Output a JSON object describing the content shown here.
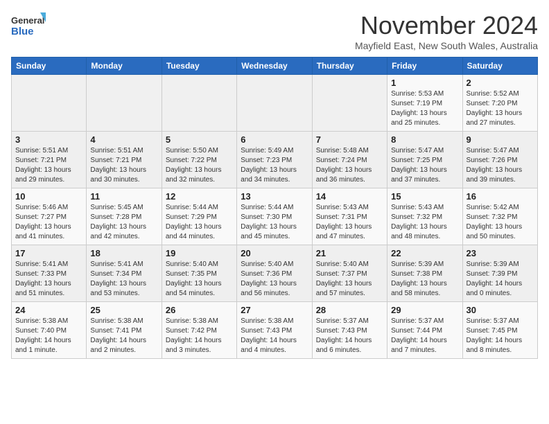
{
  "logo": {
    "line1": "General",
    "line2": "Blue"
  },
  "title": "November 2024",
  "subtitle": "Mayfield East, New South Wales, Australia",
  "weekdays": [
    "Sunday",
    "Monday",
    "Tuesday",
    "Wednesday",
    "Thursday",
    "Friday",
    "Saturday"
  ],
  "weeks": [
    [
      {
        "day": "",
        "info": ""
      },
      {
        "day": "",
        "info": ""
      },
      {
        "day": "",
        "info": ""
      },
      {
        "day": "",
        "info": ""
      },
      {
        "day": "",
        "info": ""
      },
      {
        "day": "1",
        "info": "Sunrise: 5:53 AM\nSunset: 7:19 PM\nDaylight: 13 hours\nand 25 minutes."
      },
      {
        "day": "2",
        "info": "Sunrise: 5:52 AM\nSunset: 7:20 PM\nDaylight: 13 hours\nand 27 minutes."
      }
    ],
    [
      {
        "day": "3",
        "info": "Sunrise: 5:51 AM\nSunset: 7:21 PM\nDaylight: 13 hours\nand 29 minutes."
      },
      {
        "day": "4",
        "info": "Sunrise: 5:51 AM\nSunset: 7:21 PM\nDaylight: 13 hours\nand 30 minutes."
      },
      {
        "day": "5",
        "info": "Sunrise: 5:50 AM\nSunset: 7:22 PM\nDaylight: 13 hours\nand 32 minutes."
      },
      {
        "day": "6",
        "info": "Sunrise: 5:49 AM\nSunset: 7:23 PM\nDaylight: 13 hours\nand 34 minutes."
      },
      {
        "day": "7",
        "info": "Sunrise: 5:48 AM\nSunset: 7:24 PM\nDaylight: 13 hours\nand 36 minutes."
      },
      {
        "day": "8",
        "info": "Sunrise: 5:47 AM\nSunset: 7:25 PM\nDaylight: 13 hours\nand 37 minutes."
      },
      {
        "day": "9",
        "info": "Sunrise: 5:47 AM\nSunset: 7:26 PM\nDaylight: 13 hours\nand 39 minutes."
      }
    ],
    [
      {
        "day": "10",
        "info": "Sunrise: 5:46 AM\nSunset: 7:27 PM\nDaylight: 13 hours\nand 41 minutes."
      },
      {
        "day": "11",
        "info": "Sunrise: 5:45 AM\nSunset: 7:28 PM\nDaylight: 13 hours\nand 42 minutes."
      },
      {
        "day": "12",
        "info": "Sunrise: 5:44 AM\nSunset: 7:29 PM\nDaylight: 13 hours\nand 44 minutes."
      },
      {
        "day": "13",
        "info": "Sunrise: 5:44 AM\nSunset: 7:30 PM\nDaylight: 13 hours\nand 45 minutes."
      },
      {
        "day": "14",
        "info": "Sunrise: 5:43 AM\nSunset: 7:31 PM\nDaylight: 13 hours\nand 47 minutes."
      },
      {
        "day": "15",
        "info": "Sunrise: 5:43 AM\nSunset: 7:32 PM\nDaylight: 13 hours\nand 48 minutes."
      },
      {
        "day": "16",
        "info": "Sunrise: 5:42 AM\nSunset: 7:32 PM\nDaylight: 13 hours\nand 50 minutes."
      }
    ],
    [
      {
        "day": "17",
        "info": "Sunrise: 5:41 AM\nSunset: 7:33 PM\nDaylight: 13 hours\nand 51 minutes."
      },
      {
        "day": "18",
        "info": "Sunrise: 5:41 AM\nSunset: 7:34 PM\nDaylight: 13 hours\nand 53 minutes."
      },
      {
        "day": "19",
        "info": "Sunrise: 5:40 AM\nSunset: 7:35 PM\nDaylight: 13 hours\nand 54 minutes."
      },
      {
        "day": "20",
        "info": "Sunrise: 5:40 AM\nSunset: 7:36 PM\nDaylight: 13 hours\nand 56 minutes."
      },
      {
        "day": "21",
        "info": "Sunrise: 5:40 AM\nSunset: 7:37 PM\nDaylight: 13 hours\nand 57 minutes."
      },
      {
        "day": "22",
        "info": "Sunrise: 5:39 AM\nSunset: 7:38 PM\nDaylight: 13 hours\nand 58 minutes."
      },
      {
        "day": "23",
        "info": "Sunrise: 5:39 AM\nSunset: 7:39 PM\nDaylight: 14 hours\nand 0 minutes."
      }
    ],
    [
      {
        "day": "24",
        "info": "Sunrise: 5:38 AM\nSunset: 7:40 PM\nDaylight: 14 hours\nand 1 minute."
      },
      {
        "day": "25",
        "info": "Sunrise: 5:38 AM\nSunset: 7:41 PM\nDaylight: 14 hours\nand 2 minutes."
      },
      {
        "day": "26",
        "info": "Sunrise: 5:38 AM\nSunset: 7:42 PM\nDaylight: 14 hours\nand 3 minutes."
      },
      {
        "day": "27",
        "info": "Sunrise: 5:38 AM\nSunset: 7:43 PM\nDaylight: 14 hours\nand 4 minutes."
      },
      {
        "day": "28",
        "info": "Sunrise: 5:37 AM\nSunset: 7:43 PM\nDaylight: 14 hours\nand 6 minutes."
      },
      {
        "day": "29",
        "info": "Sunrise: 5:37 AM\nSunset: 7:44 PM\nDaylight: 14 hours\nand 7 minutes."
      },
      {
        "day": "30",
        "info": "Sunrise: 5:37 AM\nSunset: 7:45 PM\nDaylight: 14 hours\nand 8 minutes."
      }
    ]
  ]
}
